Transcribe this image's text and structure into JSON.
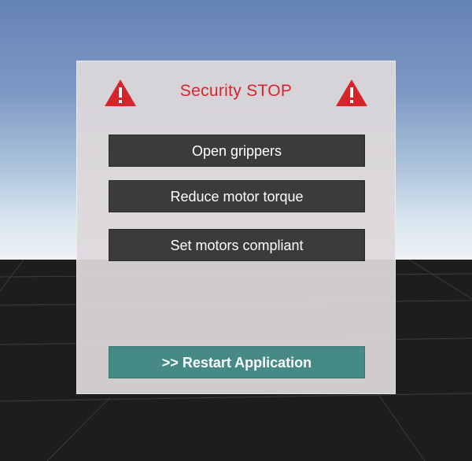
{
  "dialog": {
    "title": "Security STOP",
    "warning_icon": "warning-triangle-icon",
    "buttons": {
      "open_grippers": "Open grippers",
      "reduce_torque": "Reduce motor torque",
      "compliant": "Set motors compliant",
      "restart": ">> Restart Application"
    }
  },
  "colors": {
    "title": "#d6252a",
    "button_bg": "#3b3b3b",
    "restart_bg": "#458a84",
    "panel_bg": "#ded8da"
  }
}
